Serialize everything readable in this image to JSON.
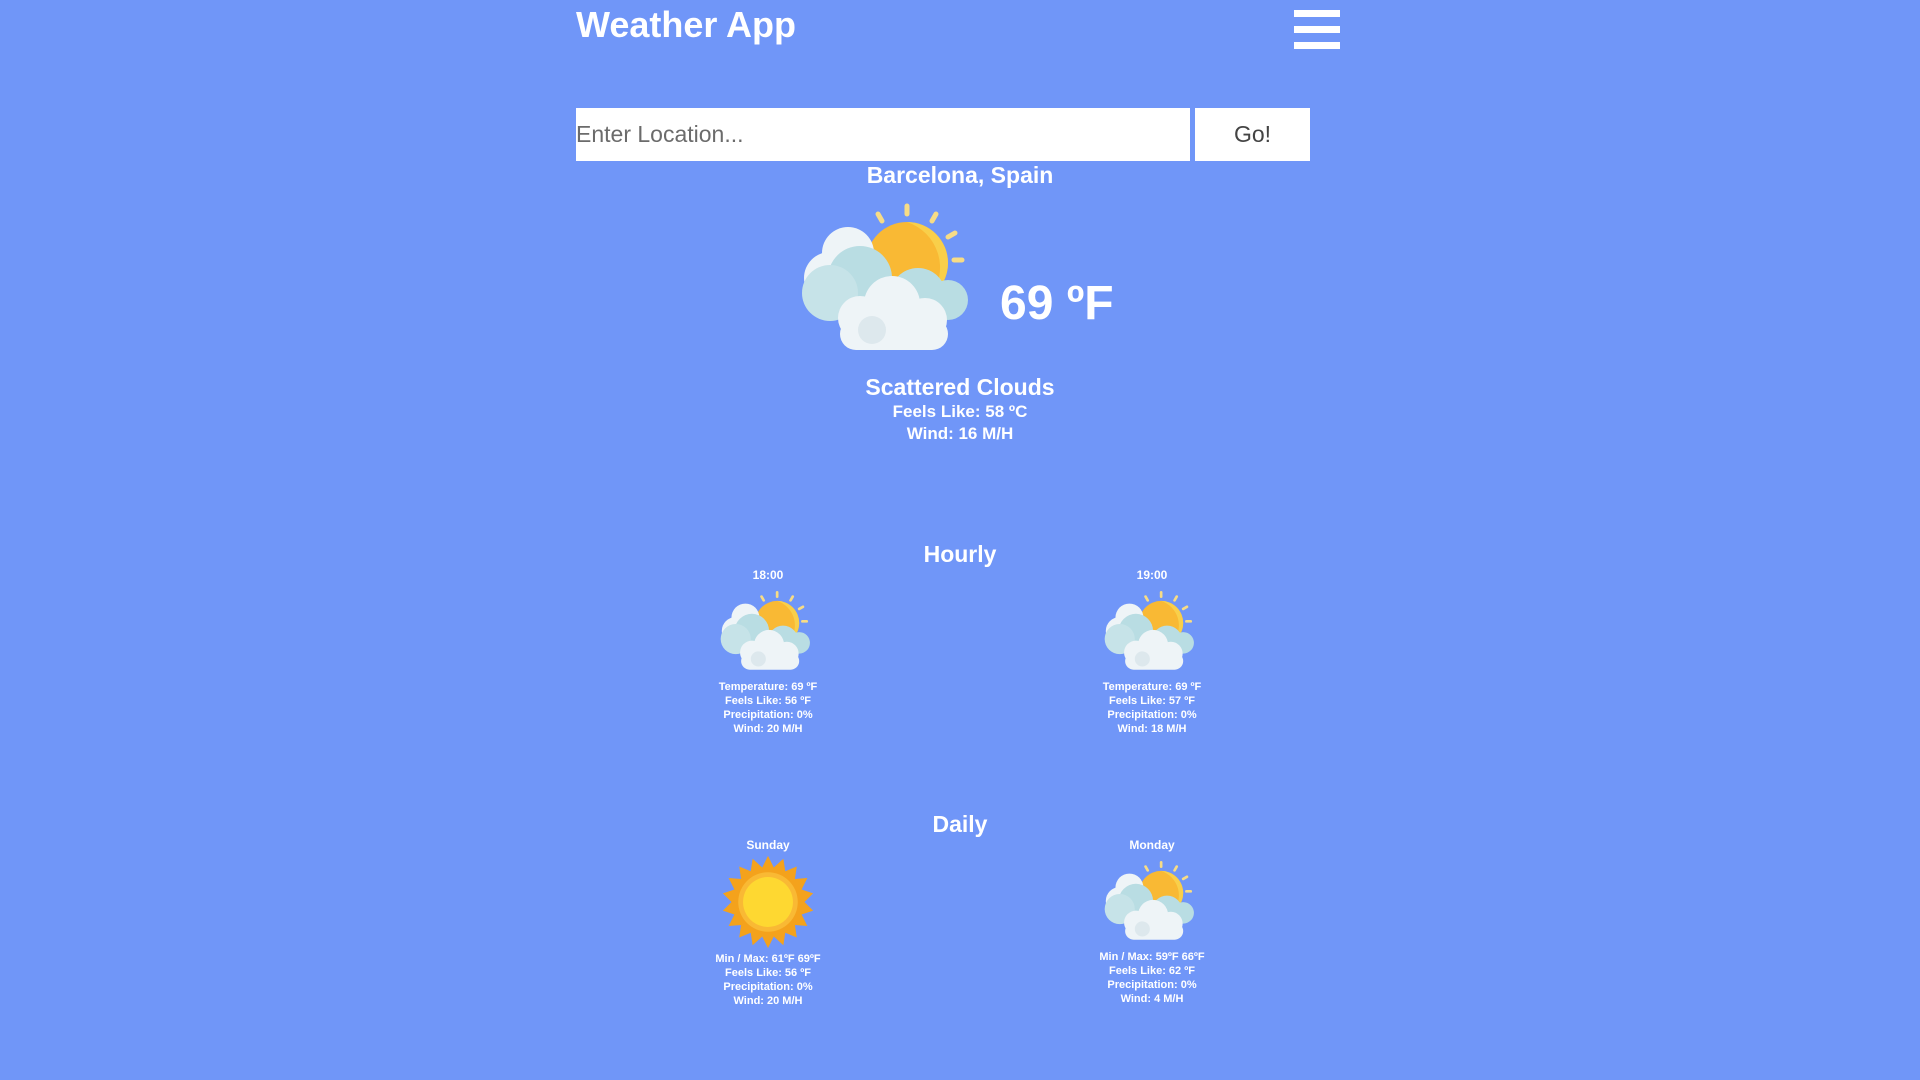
{
  "header": {
    "title": "Weather App",
    "menu_icon": "hamburger-menu-icon"
  },
  "search": {
    "placeholder": "Enter Location...",
    "value": "",
    "go_label": "Go!"
  },
  "current": {
    "location": "Barcelona, Spain",
    "icon": "partly-cloudy-icon",
    "temperature": "69 ºF",
    "condition": "Scattered Clouds",
    "feels_like": "Feels Like: 58 ºC",
    "wind": "Wind: 16 M/H"
  },
  "hourly": {
    "title": "Hourly",
    "items": [
      {
        "time": "18:00",
        "icon": "partly-cloudy-icon",
        "temperature": "Temperature: 69 ºF",
        "feels_like": "Feels Like: 56 ºF",
        "precipitation": "Precipitation: 0%",
        "wind": "Wind: 20 M/H"
      },
      {
        "time": "19:00",
        "icon": "partly-cloudy-icon",
        "temperature": "Temperature: 69 ºF",
        "feels_like": "Feels Like: 57 ºF",
        "precipitation": "Precipitation: 0%",
        "wind": "Wind: 18 M/H"
      }
    ]
  },
  "daily": {
    "title": "Daily",
    "items": [
      {
        "day": "Sunday",
        "icon": "sun-icon",
        "min_max": "Min / Max: 61ºF 69ºF",
        "feels_like": "Feels Like: 56 ºF",
        "precipitation": "Precipitation: 0%",
        "wind": "Wind: 20 M/H"
      },
      {
        "day": "Monday",
        "icon": "partly-cloudy-icon",
        "min_max": "Min / Max: 59ºF 66ºF",
        "feels_like": "Feels Like: 62 ºF",
        "precipitation": "Precipitation: 0%",
        "wind": "Wind: 4 M/H"
      }
    ]
  },
  "colors": {
    "background": "#7096f8",
    "text": "#ffffff",
    "sun": "#f9b934",
    "cloud": "#eef4f7",
    "cloud_shade": "#b9dde3"
  }
}
